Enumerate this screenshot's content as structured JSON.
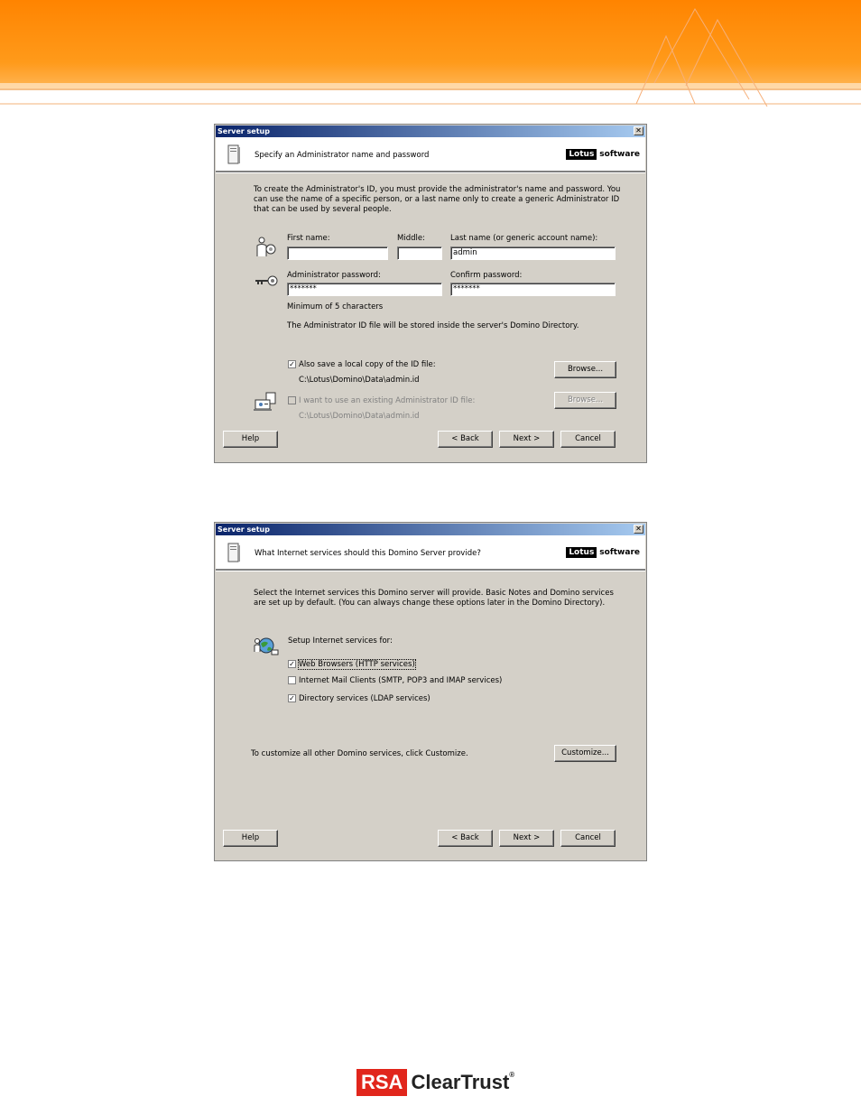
{
  "dialog1": {
    "title": "Server setup",
    "close": "✕",
    "header_text": "Specify an Administrator name and password",
    "brand_box": "Lotus",
    "brand_word": "software",
    "intro_line1": "To create the Administrator's ID, you must provide the administrator's name and password. You",
    "intro_line2": "can use the name of a specific person, or a last name only to create a generic Administrator ID",
    "intro_line3": "that can be used by several people.",
    "first_name_label": "First name:",
    "first_name_value": "",
    "middle_label": "Middle:",
    "middle_value": "",
    "last_name_label": "Last name (or generic account name):",
    "last_name_value": "admin",
    "password_label": "Administrator password:",
    "password_value": "*******",
    "confirm_label": "Confirm password:",
    "confirm_value": "*******",
    "min_chars": "Minimum of 5 characters",
    "stored_note": "The Administrator ID file will be stored inside the server's Domino Directory.",
    "save_local_label": "Also save a local copy of the ID file:",
    "save_local_checked": true,
    "save_local_path": "C:\\Lotus\\Domino\\Data\\admin.id",
    "browse1": "Browse...",
    "existing_label": "I want to use an existing Administrator ID file:",
    "existing_checked": false,
    "existing_path": "C:\\Lotus\\Domino\\Data\\admin.id",
    "browse2": "Browse...",
    "help": "Help",
    "back": "< Back",
    "next": "Next >",
    "cancel": "Cancel"
  },
  "dialog2": {
    "title": "Server setup",
    "close": "✕",
    "header_text": "What Internet services should this Domino Server provide?",
    "brand_box": "Lotus",
    "brand_word": "software",
    "intro_line1": "Select the Internet services this Domino server will provide. Basic Notes and Domino services",
    "intro_line2": "are set up by default. (You can always change these options later in the Domino Directory).",
    "setup_label": "Setup Internet services for:",
    "services": [
      {
        "label": "Web Browsers (HTTP services)",
        "checked": true
      },
      {
        "label": "Internet Mail Clients (SMTP, POP3 and IMAP services)",
        "checked": false
      },
      {
        "label": "Directory services (LDAP services)",
        "checked": true
      }
    ],
    "customize_text": "To customize all other Domino services, click Customize.",
    "customize": "Customize...",
    "help": "Help",
    "back": "< Back",
    "next": "Next >",
    "cancel": "Cancel"
  },
  "footer": {
    "logo_rsa": "RSA",
    "logo_product": "ClearTrust",
    "logo_reg": "®"
  },
  "colors": {
    "banner_orange": "#ff8c00",
    "dialog_face": "#d4d0c8",
    "title_active": "#0a246a",
    "rsa_red": "#e1261c"
  }
}
